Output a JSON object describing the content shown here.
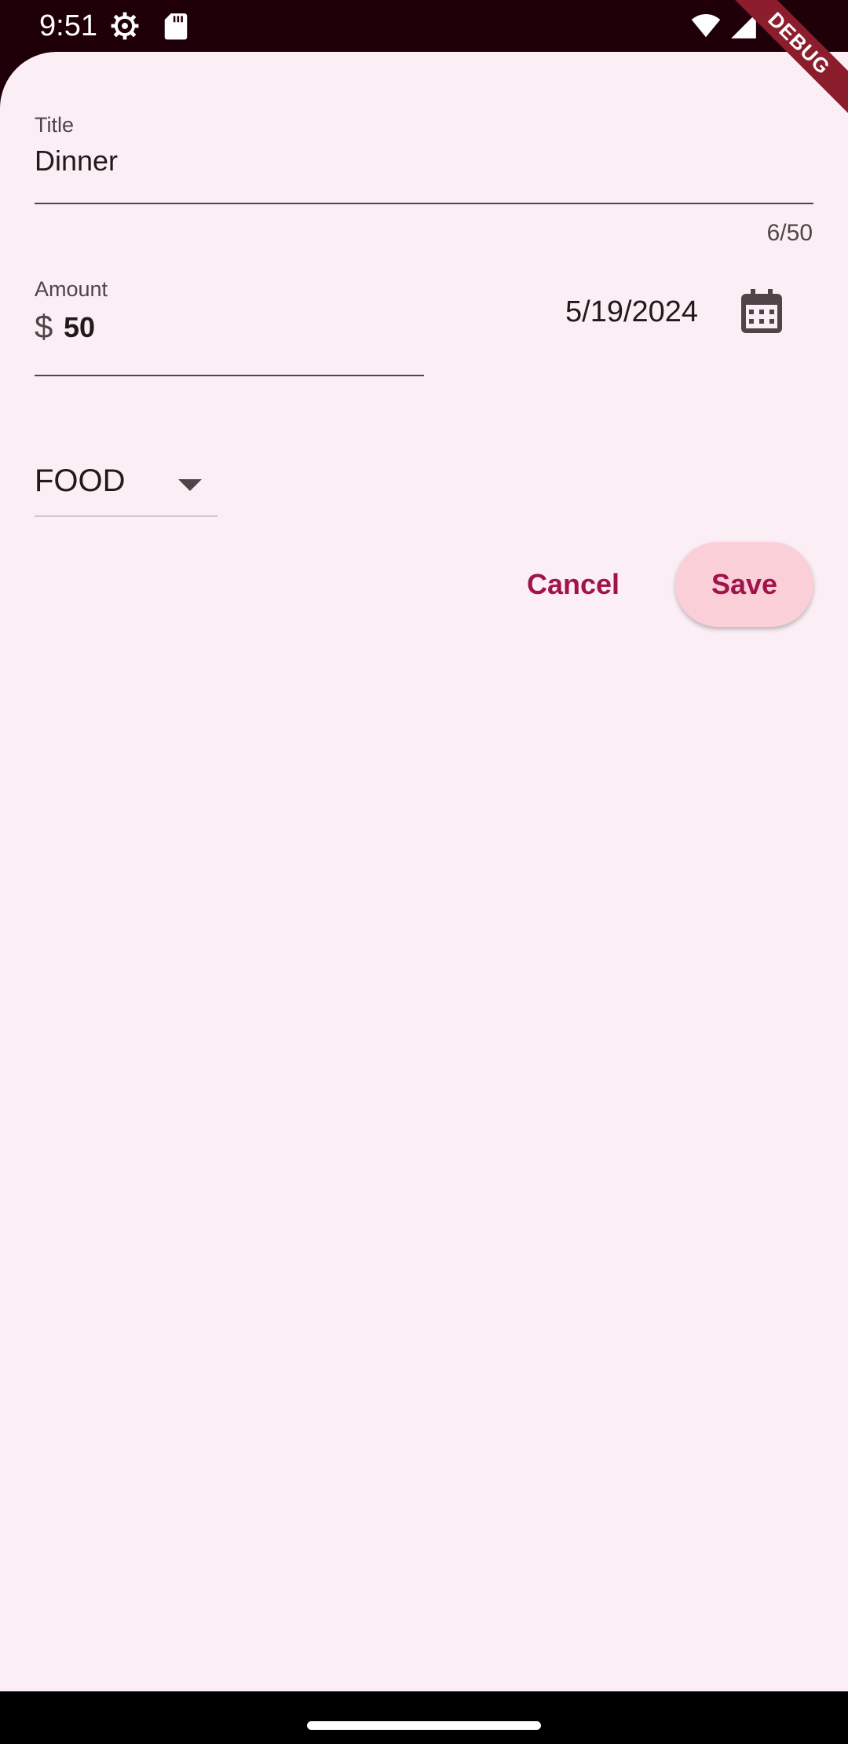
{
  "status_bar": {
    "time": "9:51",
    "icons": [
      "settings-icon",
      "sd-card-icon",
      "wifi-icon",
      "signal-icon",
      "battery-icon"
    ]
  },
  "debug_banner": "DEBUG",
  "form": {
    "title": {
      "label": "Title",
      "value": "Dinner",
      "counter": "6/50"
    },
    "amount": {
      "label": "Amount",
      "prefix": "$",
      "value": "50"
    },
    "date": {
      "value": "5/19/2024"
    },
    "category": {
      "selected": "FOOD"
    },
    "actions": {
      "cancel_label": "Cancel",
      "save_label": "Save"
    }
  },
  "colors": {
    "sheet_background": "#fbeef5",
    "accent": "#a0134b",
    "save_button_background": "#fbcfd8",
    "status_bar_background": "#1f0008"
  }
}
